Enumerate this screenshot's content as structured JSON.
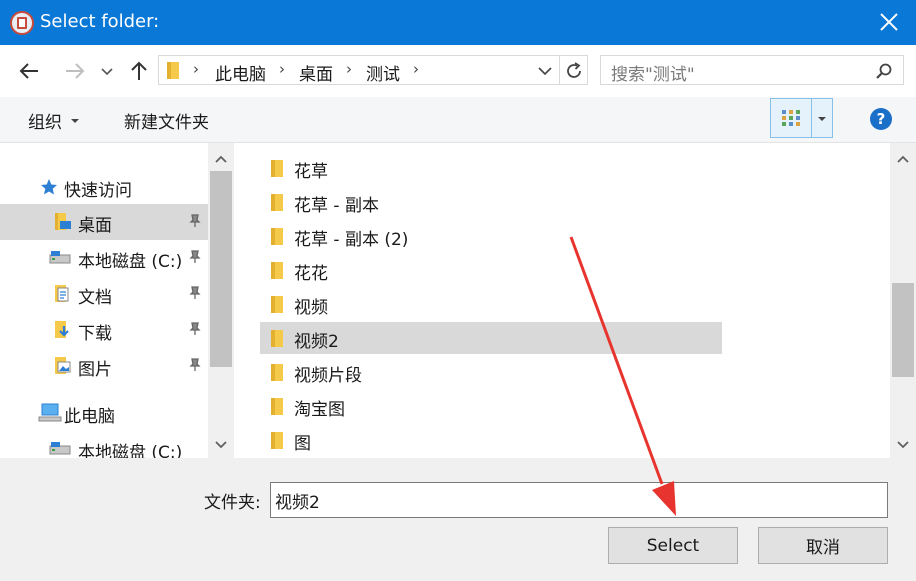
{
  "window": {
    "title": "Select folder:",
    "icon": "film-app-icon",
    "accent": "#0a78d7"
  },
  "address": {
    "crumbs": [
      "此电脑",
      "桌面",
      "测试"
    ],
    "search_placeholder": "搜索\"测试\""
  },
  "toolbar": {
    "organize_label": "组织",
    "new_folder_label": "新建文件夹",
    "help_label": "?"
  },
  "nav": {
    "items": [
      {
        "label": "快速访问",
        "icon": "star-icon",
        "pinned": false
      },
      {
        "label": "桌面",
        "icon": "desktop-folder-icon",
        "pinned": true,
        "selected": true
      },
      {
        "label": "本地磁盘 (C:)",
        "icon": "drive-icon",
        "pinned": true
      },
      {
        "label": "文档",
        "icon": "documents-icon",
        "pinned": true
      },
      {
        "label": "下载",
        "icon": "download-icon",
        "pinned": true
      },
      {
        "label": "图片",
        "icon": "pictures-icon",
        "pinned": true
      },
      {
        "label": "此电脑",
        "icon": "computer-icon",
        "pinned": false
      },
      {
        "label": "本地磁盘 (C:)",
        "icon": "drive-icon",
        "pinned": false
      }
    ]
  },
  "files": {
    "items": [
      {
        "label": "花草"
      },
      {
        "label": "花草 - 副本"
      },
      {
        "label": "花草 - 副本 (2)"
      },
      {
        "label": "花花"
      },
      {
        "label": "视频"
      },
      {
        "label": "视频2",
        "selected": true
      },
      {
        "label": "视频片段"
      },
      {
        "label": "淘宝图"
      },
      {
        "label": "图"
      }
    ]
  },
  "footer": {
    "folder_label": "文件夹:",
    "folder_value": "视频2",
    "select_label": "Select",
    "cancel_label": "取消"
  }
}
